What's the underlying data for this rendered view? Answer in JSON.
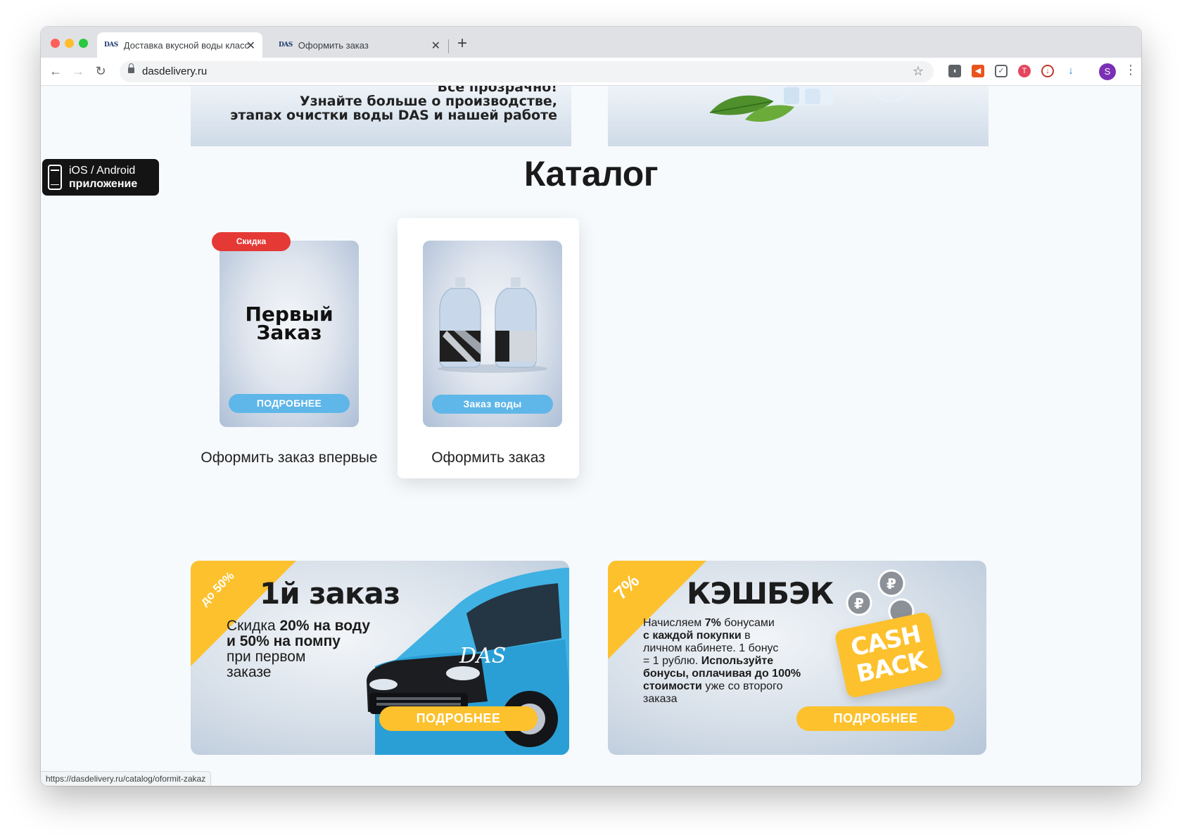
{
  "browser": {
    "tabs": [
      {
        "favicon": "DAS",
        "title": "Доставка вкусной воды класс"
      },
      {
        "favicon": "DAS",
        "title": "Оформить заказ"
      }
    ],
    "url": "dasdelivery.ru",
    "avatar_letter": "S",
    "status_url": "https://dasdelivery.ru/catalog/oformit-zakaz"
  },
  "top_banner": {
    "line1": "Все прозрачно!",
    "line2": "Узнайте больше о производстве,",
    "line3": "этапах очистки воды DAS и нашей работе"
  },
  "app_badge": {
    "line1": "iOS / Android",
    "line2": "приложение"
  },
  "catalog": {
    "title": "Каталог",
    "products": [
      {
        "badge": "Скидка",
        "image_title_1": "Первый",
        "image_title_2": "Заказ",
        "image_button": "ПОДРОБНЕЕ",
        "caption": "Оформить заказ впервые"
      },
      {
        "image_button": "Заказ воды",
        "caption": "Оформить заказ"
      }
    ]
  },
  "promos": [
    {
      "corner": "до 50%",
      "title": "1й заказ",
      "body_1a": "Скидка ",
      "body_1b": "20% на воду",
      "body_2": "и 50% на помпу",
      "body_3": "при первом",
      "body_4": "заказе",
      "van_logo": "DAS",
      "button": "ПОДРОБНЕЕ"
    },
    {
      "corner": "7%",
      "title": "КЭШБЭК",
      "l1a": "Начисляем ",
      "l1b": "7%",
      "l1c": " бонусами",
      "l2a": "с каждой покупки",
      "l2b": " в",
      "l3": "личном кабинете. 1 бонус",
      "l4a": "= 1 рублю. ",
      "l4b": "Используйте",
      "l5": "бонусы, оплачивая до 100%",
      "l6a": "стоимости",
      "l6b": " уже со второго",
      "l7": "заказа",
      "stamp_1": "CASH",
      "stamp_2": "BACK",
      "button": "ПОДРОБНЕЕ"
    }
  ],
  "colors": {
    "accent_red": "#e53935",
    "accent_yellow": "#fcc12d",
    "accent_blue": "#5fb6e8"
  }
}
